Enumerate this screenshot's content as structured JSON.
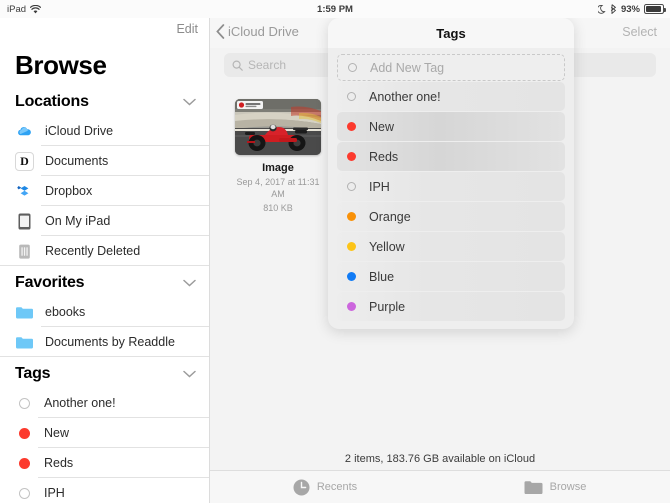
{
  "status_bar": {
    "device": "iPad",
    "wifi_icon": "wifi-icon",
    "time": "1:59 PM",
    "dnd_icon": "moon-icon",
    "bluetooth_icon": "bluetooth-icon",
    "battery_percent": "93%",
    "battery_icon": "battery-icon"
  },
  "sidebar": {
    "edit_label": "Edit",
    "title": "Browse",
    "sections": [
      {
        "title": "Locations",
        "collapse_icon": "chevron-down-icon",
        "items": [
          {
            "label": "iCloud Drive",
            "icon": "icloud-drive-icon"
          },
          {
            "label": "Documents",
            "icon": "documents-app-icon"
          },
          {
            "label": "Dropbox",
            "icon": "dropbox-icon"
          },
          {
            "label": "On My iPad",
            "icon": "ipad-icon"
          },
          {
            "label": "Recently Deleted",
            "icon": "trash-icon"
          }
        ]
      },
      {
        "title": "Favorites",
        "collapse_icon": "chevron-down-icon",
        "items": [
          {
            "label": "ebooks",
            "icon": "folder-icon"
          },
          {
            "label": "Documents by Readdle",
            "icon": "folder-icon"
          }
        ]
      },
      {
        "title": "Tags",
        "collapse_icon": "chevron-down-icon",
        "items": [
          {
            "label": "Another one!",
            "color": "none"
          },
          {
            "label": "New",
            "color": "#fc3a2d"
          },
          {
            "label": "Reds",
            "color": "#fc3a2d"
          },
          {
            "label": "IPH",
            "color": "none"
          }
        ]
      }
    ]
  },
  "main": {
    "back_label": "iCloud Drive",
    "back_icon": "chevron-left-icon",
    "select_label": "Select",
    "search": {
      "placeholder": "Search",
      "icon": "search-icon"
    },
    "files": [
      {
        "name": "Image",
        "date": "Sep 4, 2017 at 11:31 AM",
        "size": "810 KB",
        "thumbnail": "formula-1-car-photo"
      }
    ],
    "status_text": "2 items, 183.76 GB available on iCloud"
  },
  "tab_bar": {
    "tabs": [
      {
        "label": "Recents",
        "icon": "clock-icon"
      },
      {
        "label": "Browse",
        "icon": "folder-icon"
      }
    ]
  },
  "tags_popover": {
    "title": "Tags",
    "add_new": {
      "label": "Add New Tag",
      "color": "none"
    },
    "rows": [
      {
        "label": "Another one!",
        "color": "none",
        "selected": false
      },
      {
        "label": "New",
        "color": "#fc3a2d",
        "selected": true
      },
      {
        "label": "Reds",
        "color": "#fc3a2d",
        "selected": true
      },
      {
        "label": "IPH",
        "color": "none",
        "selected": false
      },
      {
        "label": "Orange",
        "color": "#f99108",
        "selected": false
      },
      {
        "label": "Yellow",
        "color": "#fcc418",
        "selected": false
      },
      {
        "label": "Blue",
        "color": "#117bf5",
        "selected": false
      },
      {
        "label": "Purple",
        "color": "#cc66dd",
        "selected": false
      }
    ]
  }
}
